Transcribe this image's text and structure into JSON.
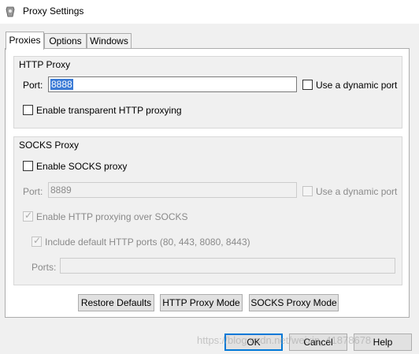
{
  "window": {
    "title": "Proxy Settings",
    "icon": "app-gear-icon"
  },
  "tabs": [
    {
      "label": "Proxies",
      "active": true
    },
    {
      "label": "Options",
      "active": false
    },
    {
      "label": "Windows",
      "active": false
    }
  ],
  "http_proxy": {
    "group_title": "HTTP Proxy",
    "port_label": "Port:",
    "port_value": "8888",
    "dynamic_port_label": "Use a dynamic port",
    "dynamic_port_checked": false,
    "transparent_label": "Enable transparent HTTP proxying",
    "transparent_checked": false
  },
  "socks_proxy": {
    "group_title": "SOCKS Proxy",
    "enable_label": "Enable SOCKS proxy",
    "enable_checked": false,
    "port_label": "Port:",
    "port_value": "8889",
    "dynamic_port_label": "Use a dynamic port",
    "http_over_socks_label": "Enable HTTP proxying over SOCKS",
    "http_over_socks_checked": true,
    "include_default_label": "Include default HTTP ports (80, 443, 8080, 8443)",
    "include_default_checked": true,
    "ports_label": "Ports:",
    "ports_value": ""
  },
  "mode_buttons": {
    "restore_defaults": "Restore Defaults",
    "http_proxy_mode": "HTTP Proxy Mode",
    "socks_proxy_mode": "SOCKS Proxy Mode"
  },
  "dialog_buttons": {
    "ok": "OK",
    "cancel": "Cancel",
    "help": "Help"
  },
  "watermark": "https://blog.csdn.net/weixin_41878678",
  "colors": {
    "selection": "#3b7bd6",
    "default_button_border": "#0078d7",
    "disabled_text": "#8a8a8a"
  }
}
